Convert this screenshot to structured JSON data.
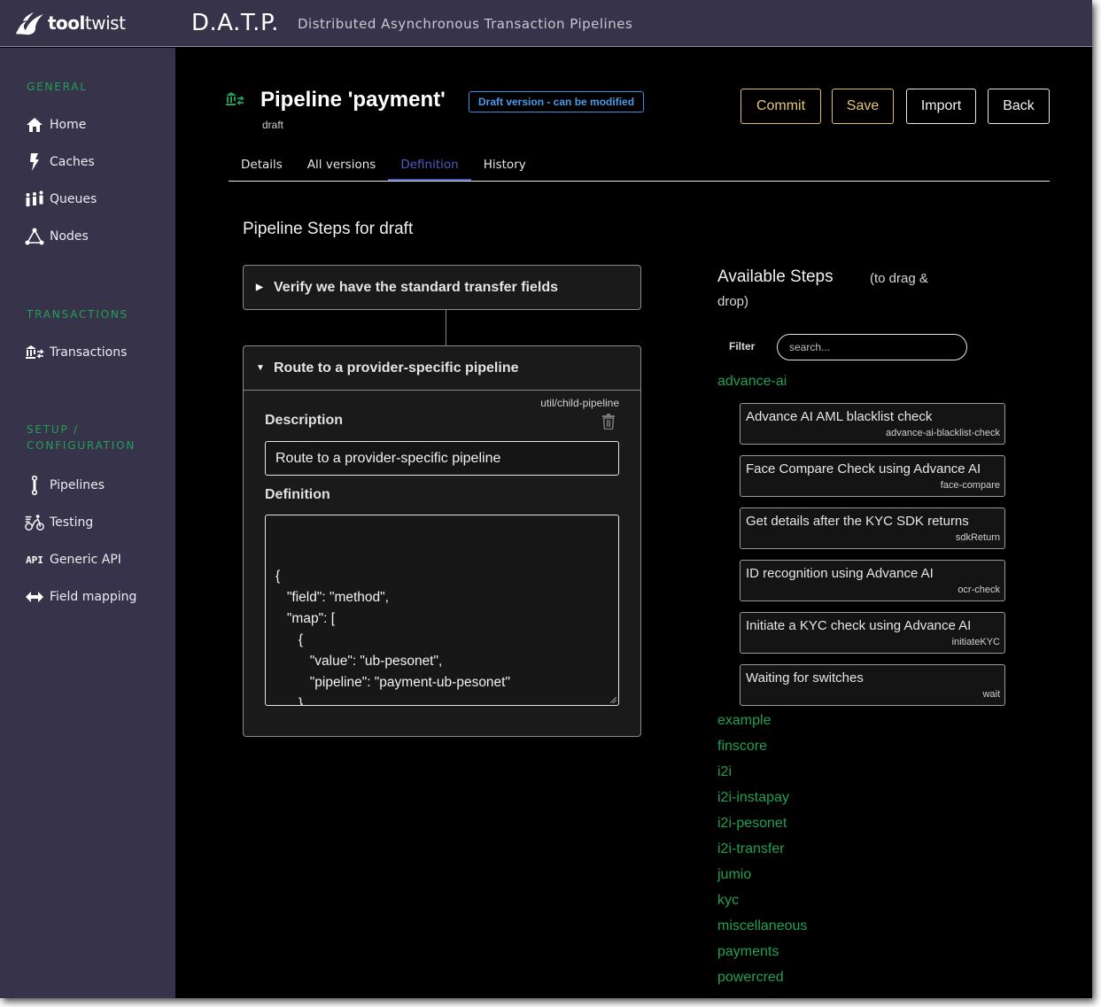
{
  "topbar": {
    "logo_bold": "tool",
    "logo_light": "twist",
    "app_title": "D.A.T.P.",
    "app_subtitle": "Distributed Asynchronous Transaction Pipelines"
  },
  "sidebar": {
    "sections": [
      {
        "label": "GENERAL",
        "items": [
          {
            "label": "Home",
            "icon": "home-icon"
          },
          {
            "label": "Caches",
            "icon": "lightning-icon"
          },
          {
            "label": "Queues",
            "icon": "people-queue-icon"
          },
          {
            "label": "Nodes",
            "icon": "network-nodes-icon"
          }
        ]
      },
      {
        "label": "TRANSACTIONS",
        "items": [
          {
            "label": "Transactions",
            "icon": "bank-transfer-icon"
          }
        ]
      },
      {
        "label_line1": "SETUP /",
        "label_line2": "CONFIGURATION",
        "items": [
          {
            "label": "Pipelines",
            "icon": "pipeline-icon"
          },
          {
            "label": "Testing",
            "icon": "cyclist-icon"
          },
          {
            "label": "Generic API",
            "icon": "api-icon"
          },
          {
            "label": "Field mapping",
            "icon": "arrows-horizontal-icon"
          }
        ]
      }
    ]
  },
  "header": {
    "title": "Pipeline 'payment'",
    "subtitle": "draft",
    "badge": "Draft version - can be modified",
    "buttons": {
      "commit": "Commit",
      "save": "Save",
      "import": "Import",
      "back": "Back"
    },
    "tabs": [
      {
        "label": "Details",
        "active": false
      },
      {
        "label": "All versions",
        "active": false
      },
      {
        "label": "Definition",
        "active": true
      },
      {
        "label": "History",
        "active": false
      }
    ]
  },
  "pipeline_steps": {
    "title": "Pipeline Steps for draft",
    "steps": [
      {
        "title": "Verify we have the standard transfer fields",
        "expanded": false
      },
      {
        "title": "Route to a provider-specific pipeline",
        "expanded": true,
        "type": "util/child-pipeline",
        "description_label": "Description",
        "description_value": "Route to a provider-specific pipeline",
        "definition_label": "Definition",
        "definition_value": "{\n   \"field\": \"method\",\n   \"map\": [\n      {\n         \"value\": \"ub-pesonet\",\n         \"pipeline\": \"payment-ub-pesonet\"\n      },\n      {\n         \"value\": \"ub-instapay\","
      }
    ]
  },
  "available_steps": {
    "title": "Available Steps",
    "hint_line1": "(to drag &",
    "hint_line2": "drop)",
    "filter_label": "Filter",
    "filter_placeholder": "search...",
    "filter_value": "",
    "expanded_category": "advance-ai",
    "steps": [
      {
        "name": "Advance AI AML blacklist check",
        "id": "advance-ai-blacklist-check"
      },
      {
        "name": "Face Compare Check using Advance AI",
        "id": "face-compare"
      },
      {
        "name": "Get details after the KYC SDK returns",
        "id": "sdkReturn"
      },
      {
        "name": "ID recognition using Advance AI",
        "id": "ocr-check"
      },
      {
        "name": "Initiate a KYC check using Advance AI",
        "id": "initiateKYC"
      },
      {
        "name": "Waiting for switches",
        "id": "wait"
      }
    ],
    "categories": [
      "example",
      "finscore",
      "i2i",
      "i2i-instapay",
      "i2i-pesonet",
      "i2i-transfer",
      "jumio",
      "kyc",
      "miscellaneous",
      "payments",
      "powercred"
    ]
  },
  "colors": {
    "sidebar_bg": "#37334b",
    "accent_green": "#22a052",
    "tab_active": "#4d5fbe",
    "badge_blue": "#4a9be6",
    "button_gold": "#e8c677"
  }
}
